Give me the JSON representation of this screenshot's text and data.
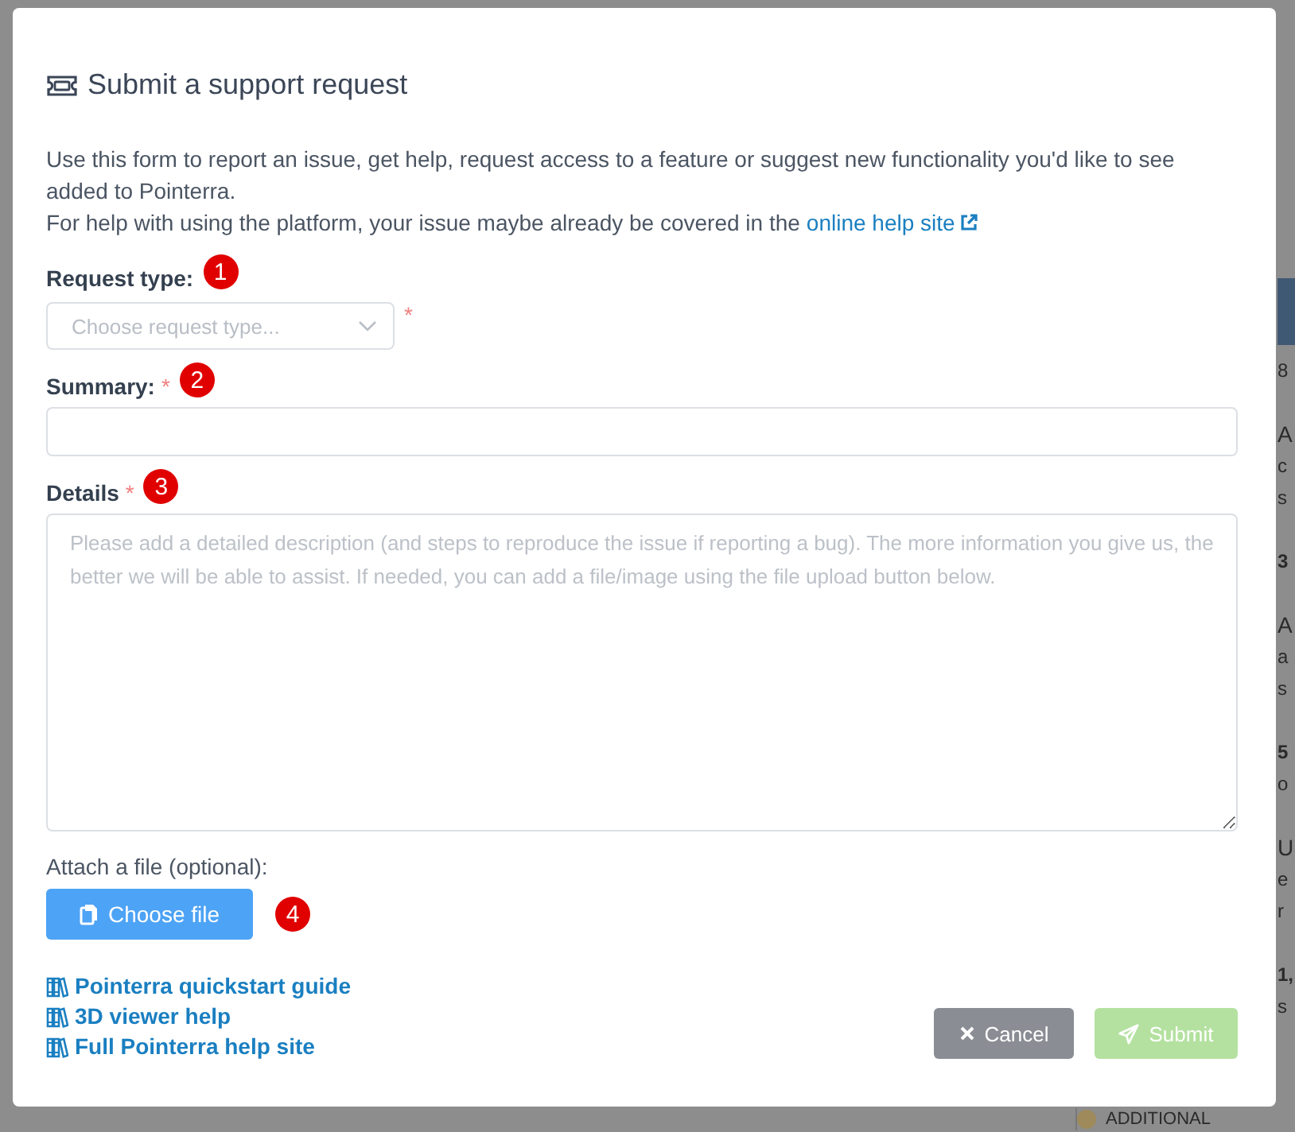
{
  "background_page": {
    "blocks": [
      {
        "lines": [
          {
            "text": "8",
            "kind": "plain"
          }
        ]
      },
      {
        "lines": [
          {
            "text": "A",
            "kind": "heading"
          },
          {
            "text": "c",
            "kind": "plain"
          },
          {
            "text": "s",
            "kind": "plain"
          }
        ]
      },
      {
        "lines": [
          {
            "text": "3",
            "kind": "bold"
          }
        ]
      },
      {
        "lines": [
          {
            "text": "A",
            "kind": "heading"
          },
          {
            "text": "a",
            "kind": "plain"
          },
          {
            "text": "s",
            "kind": "plain"
          }
        ]
      },
      {
        "lines": [
          {
            "text": "5",
            "kind": "bold"
          },
          {
            "text": "o",
            "kind": "plain"
          }
        ]
      },
      {
        "lines": [
          {
            "text": "U",
            "kind": "heading"
          },
          {
            "text": "e",
            "kind": "plain"
          },
          {
            "text": "r",
            "kind": "plain"
          }
        ]
      },
      {
        "lines": [
          {
            "text": "1,",
            "kind": "bold"
          },
          {
            "text": "s",
            "kind": "plain"
          }
        ]
      }
    ],
    "footer_heading": "ADDITIONAL"
  },
  "dialog": {
    "title": "Submit a support request",
    "intro": [
      "Use this form to report an issue, get help, request access to a feature or suggest new functionality you'd like to see added to Pointerra."
    ],
    "help_line": {
      "text": "For help with using the platform, your issue maybe already be covered in the",
      "link": "online help site"
    },
    "fields": [
      {
        "kind": "select",
        "label": "Request type:",
        "required_mark": "*",
        "marker": "1",
        "placeholder": "Choose request type..."
      },
      {
        "kind": "input",
        "label": "Summary:",
        "required_mark": "*",
        "marker": "2"
      },
      {
        "kind": "textarea",
        "label": "Details",
        "required_mark": "*",
        "marker": "3",
        "placeholder": "Please add a detailed description (and steps to reproduce the issue if reporting a bug). The more information you give us, the better we will be able to assist. If needed, you can add a file/image using the file upload button below."
      }
    ],
    "attach": {
      "label": "Attach a file (optional):",
      "button": "Choose file",
      "marker": "4"
    },
    "help_links": [
      "Pointerra quickstart guide",
      "3D viewer help",
      "Full Pointerra help site"
    ],
    "buttons": [
      {
        "kind": "cancel",
        "label": "Cancel",
        "disabled": false
      },
      {
        "kind": "submit",
        "label": "Submit",
        "disabled": true
      }
    ]
  }
}
